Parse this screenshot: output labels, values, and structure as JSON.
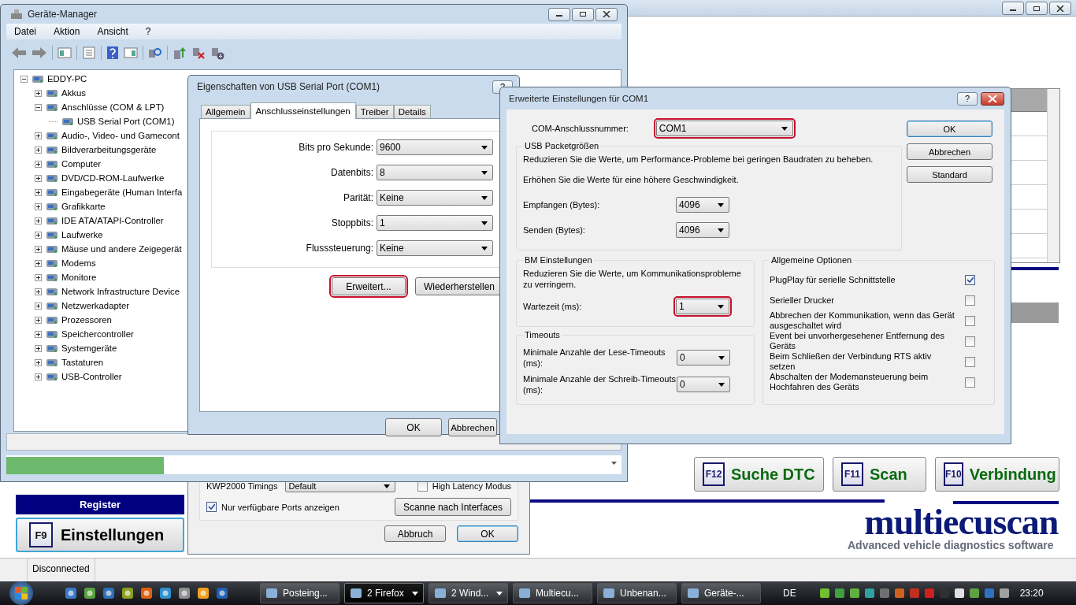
{
  "app": {
    "status": "Disconnected",
    "register_label": "Register",
    "settings_button": {
      "key": "F9",
      "label": "Einstellungen"
    },
    "function_buttons": [
      {
        "key": "F12",
        "label": "Suche DTC"
      },
      {
        "key": "F11",
        "label": "Scan"
      },
      {
        "key": "F10",
        "label": "Verbindung"
      }
    ],
    "logo": {
      "name": "multiecuscan",
      "tagline": "Advanced vehicle diagnostics software"
    }
  },
  "app_settings_dialog": {
    "kwp_label": "KWP2000 Timings",
    "kwp_value": "Default",
    "high_latency": {
      "label": "High Latency Modus",
      "checked": false
    },
    "ports_only": {
      "label": "Nur verfügbare Ports anzeigen",
      "checked": true
    },
    "scan_button": "Scanne nach Interfaces",
    "buttons": [
      {
        "label": "Abbruch",
        "default": false
      },
      {
        "label": "OK",
        "default": true
      }
    ]
  },
  "device_manager": {
    "title": "Geräte-Manager",
    "menu": [
      "Datei",
      "Aktion",
      "Ansicht",
      "?"
    ],
    "tree": {
      "label": "EDDY-PC",
      "expanded": true,
      "children": [
        {
          "label": "Akkus",
          "expanded": false
        },
        {
          "label": "Anschlüsse (COM & LPT)",
          "expanded": true,
          "children": [
            {
              "label": "USB Serial Port (COM1)"
            }
          ]
        },
        {
          "label": "Audio-, Video- und Gamecont",
          "expanded": false
        },
        {
          "label": "Bildverarbeitungsgeräte",
          "expanded": false
        },
        {
          "label": "Computer",
          "expanded": false
        },
        {
          "label": "DVD/CD-ROM-Laufwerke",
          "expanded": false
        },
        {
          "label": "Eingabegeräte (Human Interfa",
          "expanded": false
        },
        {
          "label": "Grafikkarte",
          "expanded": false
        },
        {
          "label": "IDE ATA/ATAPI-Controller",
          "expanded": false
        },
        {
          "label": "Laufwerke",
          "expanded": false
        },
        {
          "label": "Mäuse und andere Zeigegerät",
          "expanded": false
        },
        {
          "label": "Modems",
          "expanded": false
        },
        {
          "label": "Monitore",
          "expanded": false
        },
        {
          "label": "Network Infrastructure Device",
          "expanded": false
        },
        {
          "label": "Netzwerkadapter",
          "expanded": false
        },
        {
          "label": "Prozessoren",
          "expanded": false
        },
        {
          "label": "Speichercontroller",
          "expanded": false
        },
        {
          "label": "Systemgeräte",
          "expanded": false
        },
        {
          "label": "Tastaturen",
          "expanded": false
        },
        {
          "label": "USB-Controller",
          "expanded": false
        }
      ]
    }
  },
  "port_properties": {
    "title": "Eigenschaften von USB Serial Port (COM1)",
    "help": "?",
    "tabs": [
      {
        "label": "Allgemein",
        "selected": false
      },
      {
        "label": "Anschlusseinstellungen",
        "selected": true
      },
      {
        "label": "Treiber",
        "selected": false
      },
      {
        "label": "Details",
        "selected": false
      }
    ],
    "fields": [
      {
        "label": "Bits pro Sekunde:",
        "value": "9600"
      },
      {
        "label": "Datenbits:",
        "value": "8"
      },
      {
        "label": "Parität:",
        "value": "Keine"
      },
      {
        "label": "Stoppbits:",
        "value": "1"
      },
      {
        "label": "Flusssteuerung:",
        "value": "Keine"
      }
    ],
    "buttons": [
      {
        "label": "Erweitert...",
        "highlighted": true
      },
      {
        "label": "Wiederherstellen",
        "highlighted": false
      }
    ],
    "dialog_buttons": [
      "OK",
      "Abbrechen"
    ]
  },
  "advanced_settings": {
    "title": "Erweiterte Einstellungen für COM1",
    "help": "?",
    "com_port": {
      "label": "COM-Anschlussnummer:",
      "value": "COM1",
      "highlighted": true
    },
    "usb_group": {
      "title": "USB Packetgrößen",
      "notes": [
        "Reduzieren Sie die Werte, um Performance-Probleme bei geringen Baudraten zu beheben.",
        "Erhöhen Sie die Werte für eine höhere Geschwindigkeit."
      ],
      "fields": [
        {
          "label": "Empfangen (Bytes):",
          "value": "4096",
          "highlighted": false
        },
        {
          "label": "Senden (Bytes):",
          "value": "4096",
          "highlighted": false
        }
      ]
    },
    "bm_group": {
      "title": "BM Einstellungen",
      "note": "Reduzieren Sie die Werte, um Kommunikationsprobleme zu verringern.",
      "fields": [
        {
          "label": "Wartezeit (ms):",
          "value": "1",
          "highlighted": true
        }
      ]
    },
    "timeouts_group": {
      "title": "Timeouts",
      "fields": [
        {
          "label": "Minimale Anzahle der Lese-Timeouts (ms):",
          "value": "0",
          "highlighted": false
        },
        {
          "label": "Minimale Anzahle der Schreib-Timeouts (ms):",
          "value": "0",
          "highlighted": false
        }
      ]
    },
    "options_group": {
      "title": "Allgemeine Optionen",
      "items": [
        {
          "label": "PlugPlay für serielle Schnittstelle",
          "checked": true
        },
        {
          "label": "Serieller Drucker",
          "checked": false
        },
        {
          "label": "Abbrechen der Kommunikation, wenn das Gerät ausgeschaltet wird",
          "checked": false
        },
        {
          "label": "Event bei unvorhergesehener Entfernung des Geräts",
          "checked": false
        },
        {
          "label": "Beim Schließen der Verbindung RTS aktiv setzen",
          "checked": false
        },
        {
          "label": "Abschalten der Modemansteuerung beim Hochfahren des Geräts",
          "checked": false
        }
      ]
    },
    "buttons": [
      {
        "label": "OK",
        "default": true
      },
      {
        "label": "Abbrechen",
        "default": false
      },
      {
        "label": "Standard",
        "default": false
      }
    ]
  },
  "taskbar": {
    "tasks": [
      {
        "label": "Posteing...",
        "selected": false,
        "grouped": false
      },
      {
        "label": "2 Firefox",
        "selected": true,
        "grouped": true
      },
      {
        "label": "2 Wind...",
        "selected": false,
        "grouped": true
      },
      {
        "label": "Multiecu...",
        "selected": false,
        "grouped": false
      },
      {
        "label": "Unbenan...",
        "selected": false,
        "grouped": false
      },
      {
        "label": "Geräte-...",
        "selected": false,
        "grouped": false
      }
    ],
    "language": "DE",
    "clock": "23:20"
  }
}
